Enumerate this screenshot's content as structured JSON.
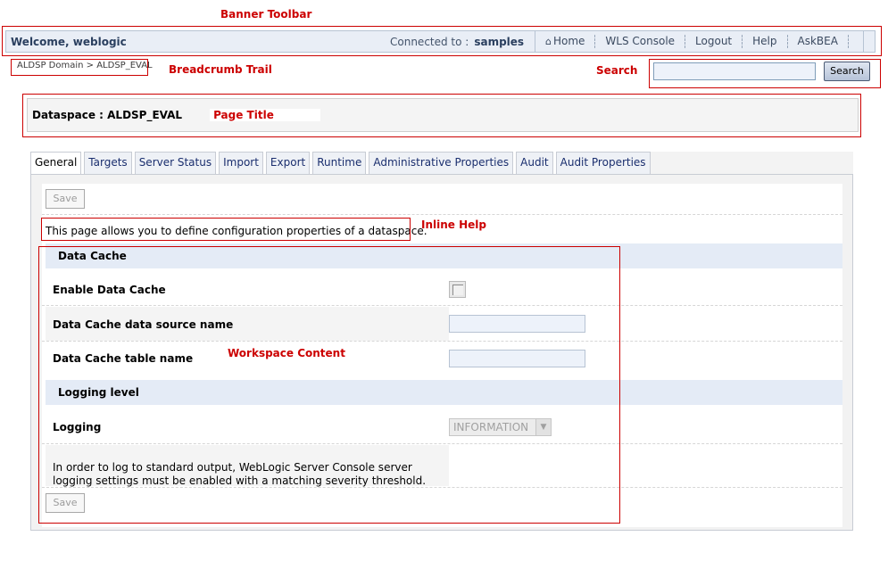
{
  "annotations": {
    "banner_toolbar": "Banner Toolbar",
    "breadcrumb_trail": "Breadcrumb Trail",
    "search": "Search",
    "page_title": "Page Title",
    "inline_help": "Inline Help",
    "workspace_content": "Workspace Content"
  },
  "banner": {
    "welcome": "Welcome, weblogic",
    "connected_label": "Connected to :",
    "connected_value": "samples",
    "nav": [
      "Home",
      "WLS Console",
      "Logout",
      "Help",
      "AskBEA"
    ]
  },
  "breadcrumb": "ALDSP Domain > ALDSP_EVAL",
  "search": {
    "button_label": "Search",
    "value": ""
  },
  "page_title": "Dataspace : ALDSP_EVAL",
  "tabs": [
    "General",
    "Targets",
    "Server Status",
    "Import",
    "Export",
    "Runtime",
    "Administrative Properties",
    "Audit",
    "Audit Properties"
  ],
  "form": {
    "save_label": "Save",
    "inline_help": "This page allows you to define configuration properties of a dataspace.",
    "section_data_cache": "Data Cache",
    "enable_data_cache_label": "Enable Data Cache",
    "data_source_label": "Data Cache data source name",
    "table_name_label": "Data Cache table name",
    "section_logging": "Logging level",
    "logging_label": "Logging",
    "logging_value": "INFORMATION",
    "logging_note": "In order to log to standard output, WebLogic Server Console server logging settings must be enabled with a matching severity threshold."
  },
  "colors": {
    "annotation": "#cc0000",
    "banner_bg": "#e9eef6",
    "section_bg": "#e4ebf6"
  }
}
